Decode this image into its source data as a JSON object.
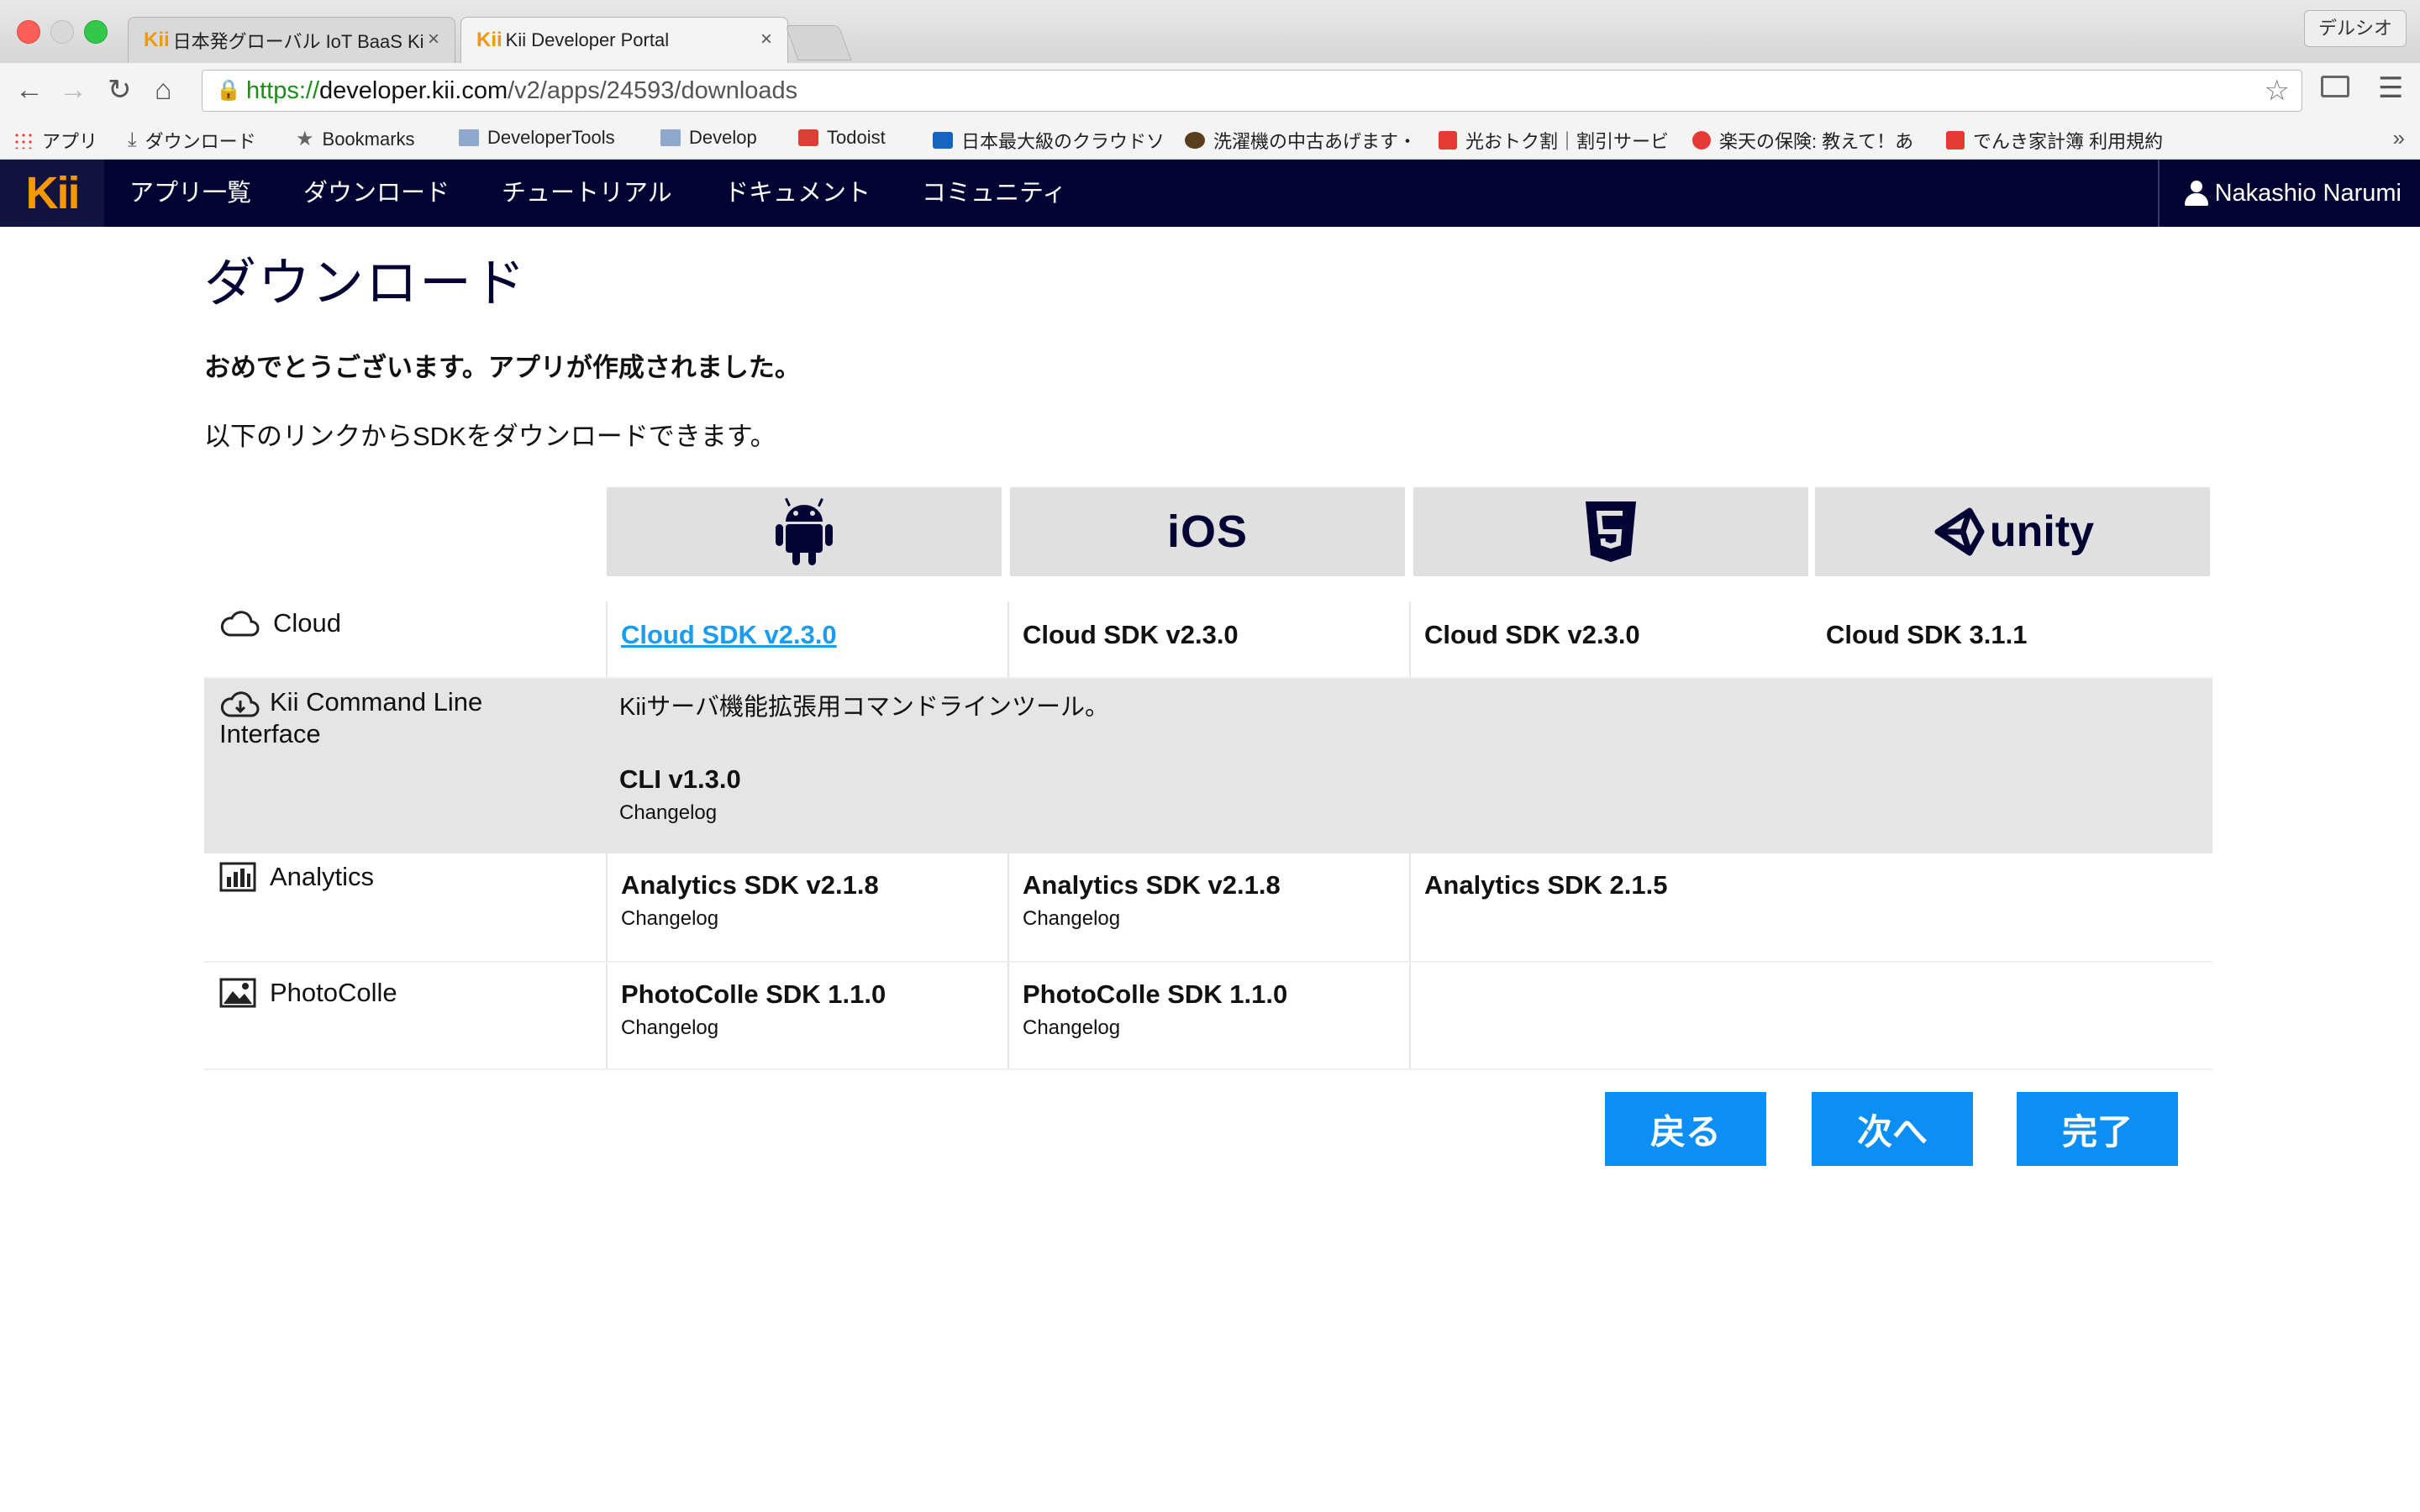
{
  "browser": {
    "tabs": [
      {
        "favicon": "Kii",
        "title": "日本発グローバル IoT BaaS Kii",
        "close": "×",
        "active": false
      },
      {
        "favicon": "Kii",
        "title": "Kii Developer Portal",
        "close": "×",
        "active": true
      }
    ],
    "profile_label": "デルシオ",
    "url_scheme": "https://",
    "url_host": "developer.kii.com",
    "url_path": "/v2/apps/24593/downloads",
    "bookmarks": [
      {
        "label": "アプリ",
        "icon": "apps-grid-icon"
      },
      {
        "label": "ダウンロード",
        "icon": "download-icon"
      },
      {
        "label": "Bookmarks",
        "icon": "star-icon"
      },
      {
        "label": "DeveloperTools",
        "icon": "folder-icon"
      },
      {
        "label": "Develop",
        "icon": "folder-icon"
      },
      {
        "label": "Todoist",
        "icon": "todoist-icon"
      },
      {
        "label": "日本最大級のクラウドソ",
        "icon": "site-icon"
      },
      {
        "label": "洗濯機の中古あげます・",
        "icon": "site-icon"
      },
      {
        "label": "光おトク割｜割引サービ",
        "icon": "site-icon"
      },
      {
        "label": "楽天の保険: 教えて！あ",
        "icon": "rakuten-icon"
      },
      {
        "label": "でんき家計簿 利用規約",
        "icon": "site-icon"
      }
    ],
    "bookmarks_more": "»"
  },
  "nav": {
    "logo": "Kii",
    "items": [
      "アプリ一覧",
      "ダウンロード",
      "チュートリアル",
      "ドキュメント",
      "コミュニティ"
    ],
    "user": "Nakashio Narumi"
  },
  "page": {
    "title": "ダウンロード",
    "congrats": "おめでとうございます。アプリが作成されました。",
    "subtitle": "以下のリンクからSDKをダウンロードできます。"
  },
  "platforms": {
    "android": "android-icon",
    "ios": "iOS",
    "html5": "html5-icon",
    "unity": "unity"
  },
  "rows": {
    "cloud": {
      "label": "Cloud",
      "android": "Cloud SDK v2.3.0",
      "ios": "Cloud SDK v2.3.0",
      "html5": "Cloud SDK v2.3.0",
      "unity": "Cloud SDK 3.1.1"
    },
    "cli": {
      "label": "Kii Command Line Interface",
      "description": "Kiiサーバ機能拡張用コマンドラインツール。",
      "version": "CLI v1.3.0",
      "changelog": "Changelog"
    },
    "analytics": {
      "label": "Analytics",
      "android": "Analytics SDK v2.1.8",
      "android_changelog": "Changelog",
      "ios": "Analytics SDK v2.1.8",
      "ios_changelog": "Changelog",
      "html5": "Analytics SDK 2.1.5"
    },
    "photocolle": {
      "label": "PhotoColle",
      "android": "PhotoColle SDK 1.1.0",
      "android_changelog": "Changelog",
      "ios": "PhotoColle SDK 1.1.0",
      "ios_changelog": "Changelog"
    }
  },
  "buttons": {
    "back": "戻る",
    "next": "次へ",
    "done": "完了"
  },
  "colors": {
    "nav_bg": "#040434",
    "logo": "#f39800",
    "link": "#1a9cf0",
    "button": "#0c8ff4",
    "row_gray": "#e5e5e5"
  }
}
